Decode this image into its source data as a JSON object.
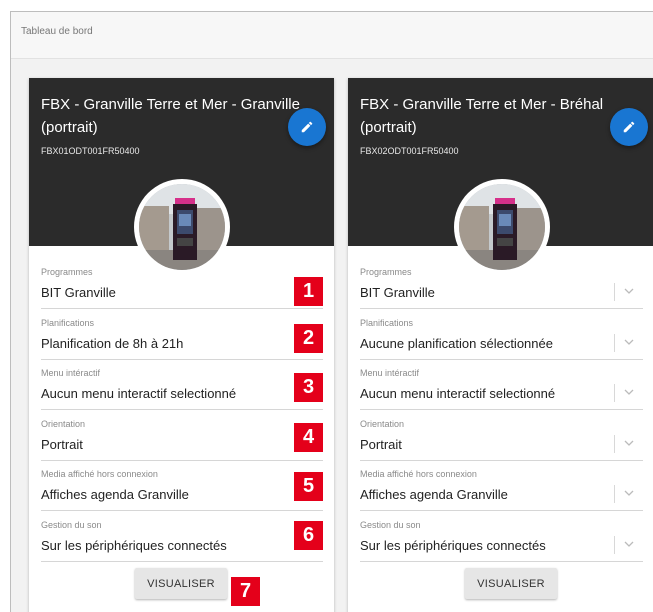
{
  "topbar": {
    "title": "Tableau de bord"
  },
  "cards": [
    {
      "title": "FBX - Granville Terre et Mer - Granville (portrait)",
      "code": "FBX01ODT001FR50400",
      "fields": [
        {
          "label": "Programmes",
          "value": "BIT Granville"
        },
        {
          "label": "Planifications",
          "value": "Planification de 8h à 21h"
        },
        {
          "label": "Menu intéractif",
          "value": "Aucun menu interactif selectionné"
        },
        {
          "label": "Orientation",
          "value": "Portrait"
        },
        {
          "label": "Media affiché hors connexion",
          "value": "Affiches agenda Granville"
        },
        {
          "label": "Gestion du son",
          "value": "Sur les périphériques connectés"
        }
      ],
      "button": "VISUALISER"
    },
    {
      "title": "FBX - Granville Terre et Mer - Bréhal (portrait)",
      "code": "FBX02ODT001FR50400",
      "fields": [
        {
          "label": "Programmes",
          "value": "BIT Granville"
        },
        {
          "label": "Planifications",
          "value": "Aucune planification sélectionnée"
        },
        {
          "label": "Menu intéractif",
          "value": "Aucun menu interactif selectionné"
        },
        {
          "label": "Orientation",
          "value": "Portrait"
        },
        {
          "label": "Media affiché hors connexion",
          "value": "Affiches agenda Granville"
        },
        {
          "label": "Gestion du son",
          "value": "Sur les périphériques connectés"
        }
      ],
      "button": "VISUALISER"
    }
  ],
  "annotations": [
    "1",
    "2",
    "3",
    "4",
    "5",
    "6",
    "7"
  ],
  "colors": {
    "accent": "#1976d2",
    "header": "#2b2b2b",
    "annotation": "#e4001a"
  },
  "icons": {
    "edit": "pencil-icon",
    "dropdown": "chevron-down-icon"
  }
}
